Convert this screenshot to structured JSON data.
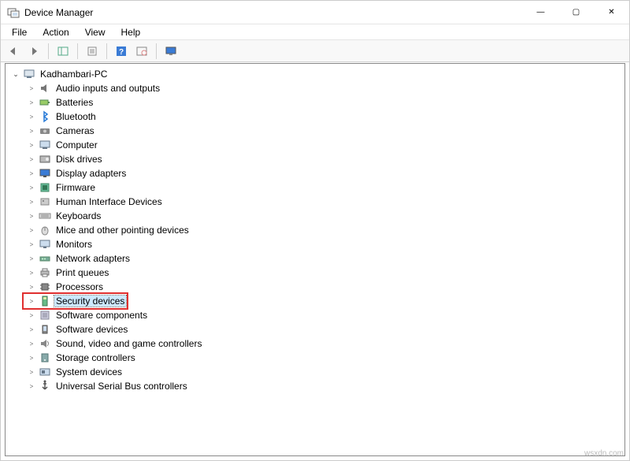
{
  "window": {
    "title": "Device Manager",
    "minimize": "—",
    "maximize": "▢",
    "close": "✕"
  },
  "menu": {
    "file": "File",
    "action": "Action",
    "view": "View",
    "help": "Help"
  },
  "toolbar_icons": {
    "back": "back-icon",
    "forward": "forward-icon",
    "showhide": "showhide-icon",
    "properties": "properties-icon",
    "help": "help-icon",
    "scan": "scan-icon",
    "monitor": "monitor-icon"
  },
  "tree": {
    "root": "Kadhambari-PC",
    "categories": [
      {
        "label": "Audio inputs and outputs",
        "icon": "audio-icon"
      },
      {
        "label": "Batteries",
        "icon": "battery-icon"
      },
      {
        "label": "Bluetooth",
        "icon": "bluetooth-icon"
      },
      {
        "label": "Cameras",
        "icon": "camera-icon"
      },
      {
        "label": "Computer",
        "icon": "computer-icon"
      },
      {
        "label": "Disk drives",
        "icon": "disk-icon"
      },
      {
        "label": "Display adapters",
        "icon": "display-icon"
      },
      {
        "label": "Firmware",
        "icon": "firmware-icon"
      },
      {
        "label": "Human Interface Devices",
        "icon": "hid-icon"
      },
      {
        "label": "Keyboards",
        "icon": "keyboard-icon"
      },
      {
        "label": "Mice and other pointing devices",
        "icon": "mouse-icon"
      },
      {
        "label": "Monitors",
        "icon": "monitor-icon"
      },
      {
        "label": "Network adapters",
        "icon": "network-icon"
      },
      {
        "label": "Print queues",
        "icon": "printer-icon"
      },
      {
        "label": "Processors",
        "icon": "processor-icon"
      },
      {
        "label": "Security devices",
        "icon": "security-icon",
        "selected": true
      },
      {
        "label": "Software components",
        "icon": "software-component-icon"
      },
      {
        "label": "Software devices",
        "icon": "software-device-icon"
      },
      {
        "label": "Sound, video and game controllers",
        "icon": "sound-icon"
      },
      {
        "label": "Storage controllers",
        "icon": "storage-icon"
      },
      {
        "label": "System devices",
        "icon": "system-icon"
      },
      {
        "label": "Universal Serial Bus controllers",
        "icon": "usb-icon"
      }
    ]
  },
  "watermark": "wsxdn.com"
}
